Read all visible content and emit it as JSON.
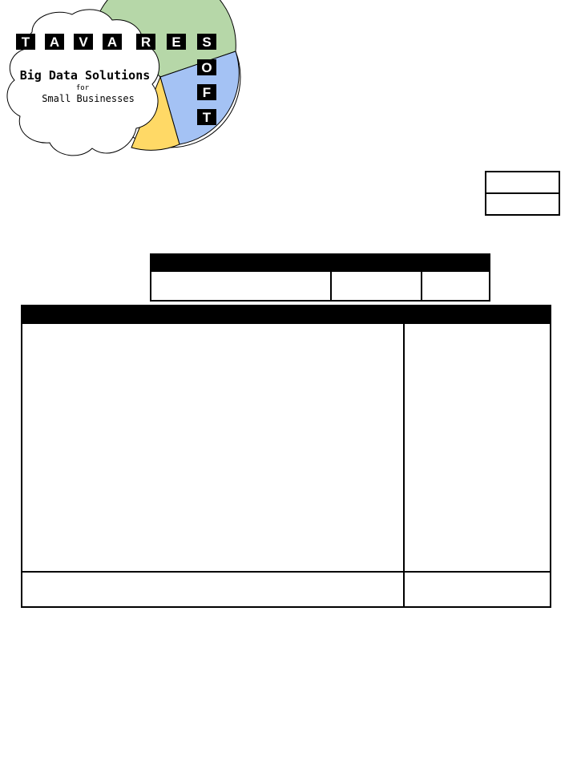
{
  "logo": {
    "letters_top": [
      "T",
      "A",
      "V",
      "A",
      "R",
      "E",
      "S"
    ],
    "letters_side": [
      "O",
      "F",
      "T"
    ],
    "tagline_1": "Big Data Solutions",
    "tagline_2": "for",
    "tagline_3": "Small Businesses",
    "colors": {
      "green": "#b6d7a8",
      "blue": "#a4c2f4",
      "yellow": "#ffd966"
    }
  }
}
